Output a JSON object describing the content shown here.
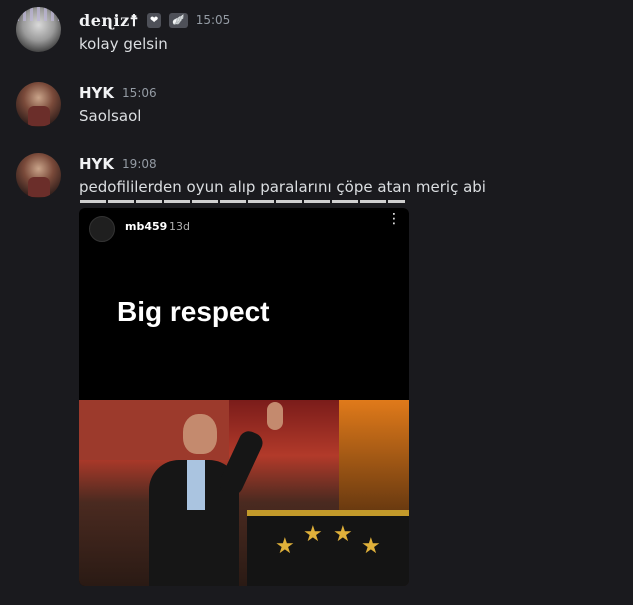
{
  "messages": [
    {
      "author": "deɳiz☨",
      "time": "15:05",
      "badges": [
        "❤",
        "🪽"
      ],
      "text": "kolay gelsin"
    },
    {
      "author": "HYK",
      "time": "15:06",
      "text": "Saolsaol"
    },
    {
      "author": "HYK",
      "time": "19:08",
      "text": "pedofililerden oyun alıp paralarını çöpe atan meriç abi"
    }
  ],
  "embed": {
    "story_user": "mb459",
    "story_age": "13d",
    "more_icon": "⋮",
    "headline": "Big respect"
  },
  "colors": {
    "background": "#1a1a1e",
    "name": "#f2f3f5",
    "timestamp": "#949ba4",
    "message": "#dbdee1"
  }
}
